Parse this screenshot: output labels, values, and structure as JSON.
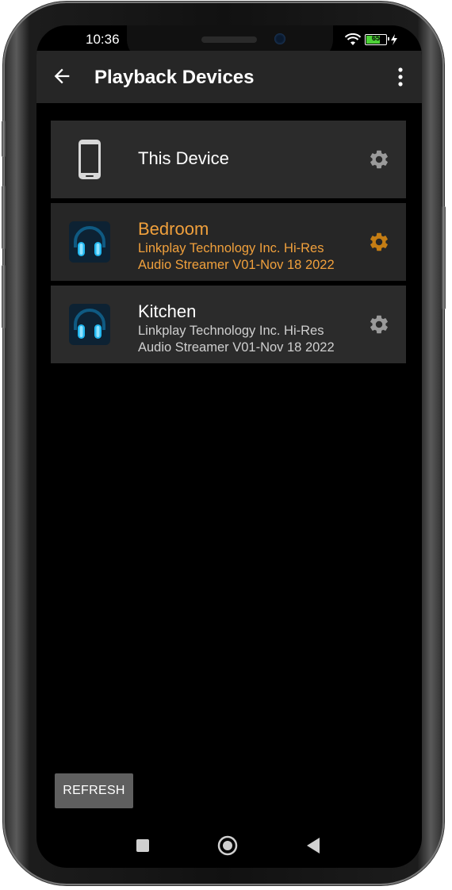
{
  "status": {
    "time": "10:36",
    "battery": "65"
  },
  "appbar": {
    "title": "Playback Devices"
  },
  "devices": [
    {
      "name": "This Device",
      "subtitle": "",
      "selected": false,
      "icon": "phone-icon"
    },
    {
      "name": "Bedroom",
      "subtitle_line1": "Linkplay Technology Inc. Hi-Res",
      "subtitle_line2": "Audio Streamer V01-Nov 18 2022",
      "selected": true,
      "icon": "headphones-app-icon"
    },
    {
      "name": "Kitchen",
      "subtitle_line1": "Linkplay Technology Inc. Hi-Res",
      "subtitle_line2": "Audio Streamer V01-Nov 18 2022",
      "selected": false,
      "icon": "headphones-app-icon"
    }
  ],
  "actions": {
    "refresh_label": "REFRESH"
  },
  "colors": {
    "accent": "#f0a03c",
    "row_bg": "#2b2b2b",
    "appbar_bg": "#262626",
    "button_bg": "#5f5f5f"
  }
}
